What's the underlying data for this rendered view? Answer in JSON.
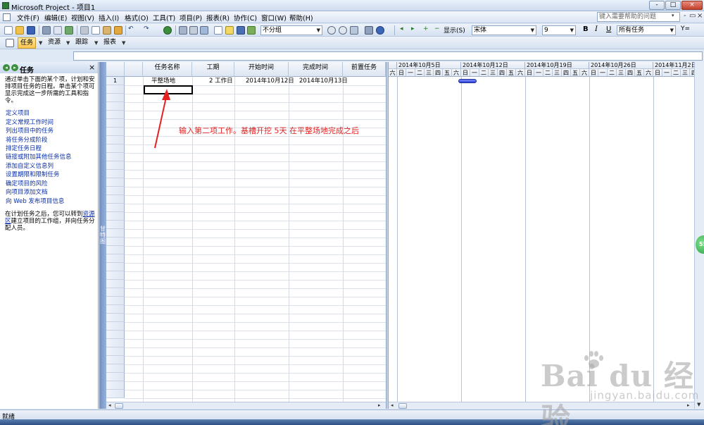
{
  "window": {
    "title": "Microsoft Project - 项目1",
    "min_label": "-",
    "max_label": "□",
    "close_label": "×"
  },
  "menu": {
    "items": [
      "文件(F)",
      "编辑(E)",
      "视图(V)",
      "插入(I)",
      "格式(O)",
      "工具(T)",
      "项目(P)",
      "报表(R)",
      "协作(C)",
      "窗口(W)",
      "帮助(H)"
    ],
    "help_placeholder": "键入需要帮助的问题",
    "help_arrow": "▾",
    "mdi_min": "-",
    "mdi_max": "▭",
    "mdi_close": "×"
  },
  "toolbar_std": {
    "group_combo": "不分组",
    "extra_arrows": [
      "◂",
      "▸",
      "+",
      "−"
    ],
    "show_label": "显示(S)",
    "font_combo": "宋体",
    "size_combo": "9",
    "bold": "B",
    "italic": "I",
    "underline": "U",
    "filter_combo": "所有任务",
    "autofilter": "Y="
  },
  "toolbar_guide": {
    "items": [
      "任务",
      "资源",
      "跟踪",
      "报表"
    ],
    "active": "任务"
  },
  "task_pane": {
    "title": "任务",
    "close": "×",
    "nav_back": "◂",
    "nav_fwd": "▸",
    "intro": "通过单击下面的某个项，计划和安排项目任务的日程。单击某个项可显示完成这一步所需的工具和指令。",
    "links": [
      "定义项目",
      "定义常规工作时间",
      "列出项目中的任务",
      "将任务分成阶段",
      "排定任务日程",
      "链接或附加其他任务信息",
      "添加自定义信息列",
      "设置期限和限制任务",
      "确定项目的风险",
      "向项目添加文档",
      "向 Web 发布项目信息"
    ],
    "footer_pre": "在计划任务之后，您可以转到",
    "footer_link": "资源区",
    "footer_post": "建立项目的工作组，并向任务分配人员。"
  },
  "view_strip": {
    "label": "甘特图"
  },
  "table": {
    "info_icon": "i",
    "columns": [
      "任务名称",
      "工期",
      "开始时间",
      "完成时间",
      "前置任务"
    ],
    "rows": [
      {
        "num": "1",
        "name": "平整场地",
        "duration": "2 工作日",
        "start": "2014年10月12日",
        "finish": "2014年10月13日",
        "pred": ""
      }
    ]
  },
  "gantt": {
    "weeks": [
      "2014年10月5日",
      "2014年10月12日",
      "2014年10月19日",
      "2014年10月26日",
      "2014年11月2日"
    ],
    "lead_day": "六",
    "days": [
      "日",
      "一",
      "二",
      "三",
      "四",
      "五",
      "六"
    ]
  },
  "annotation": "输入第二项工作。基槽开挖  5天  在平整场地完成之后",
  "status": {
    "text": "就绪"
  },
  "badge": {
    "text": "55"
  },
  "watermark": {
    "brand": "Bai du 经验",
    "domain": "jingyan.baidu.com"
  },
  "colors": {
    "accent": "#2b3fd8",
    "annotation": "#e32222",
    "link": "#0a2fa8"
  }
}
